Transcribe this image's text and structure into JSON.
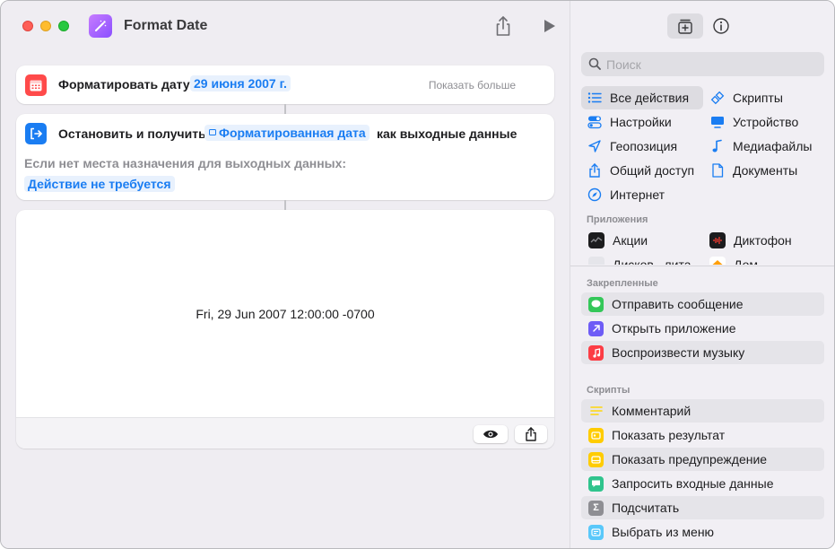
{
  "window": {
    "title": "Format Date"
  },
  "actions": {
    "format": {
      "label": "Форматировать дату",
      "token": "29 июня 2007 г.",
      "show_more": "Показать больше"
    },
    "stop": {
      "label_pre": "Остановить и получить",
      "token": "Форматированная дата",
      "label_post": "как выходные данные",
      "sub_label": "Если нет места назначения для выходных данных:",
      "sub_token": "Действие не требуется"
    },
    "output": {
      "text": "Fri, 29 Jun 2007 12:00:00 -0700"
    }
  },
  "sidebar": {
    "search_placeholder": "Поиск",
    "categories": [
      {
        "label": "Все действия",
        "icon": "list-icon",
        "selected": true
      },
      {
        "label": "Скрипты",
        "icon": "scripts-icon"
      },
      {
        "label": "Настройки",
        "icon": "toggle-icon"
      },
      {
        "label": "Устройство",
        "icon": "monitor-icon"
      },
      {
        "label": "Геопозиция",
        "icon": "location-arrow-icon"
      },
      {
        "label": "Медиафайлы",
        "icon": "music-note-icon"
      },
      {
        "label": "Общий доступ",
        "icon": "share-icon"
      },
      {
        "label": "Документы",
        "icon": "document-icon"
      },
      {
        "label": "Интернет",
        "icon": "compass-icon"
      }
    ],
    "apps_header": "Приложения",
    "apps": [
      {
        "label": "Акции",
        "icon": "stocks-icon"
      },
      {
        "label": "Диктофон",
        "icon": "voice-memos-icon"
      },
      {
        "label": "Дисков...лита",
        "icon": "disk-utility-icon"
      },
      {
        "label": "Дом",
        "icon": "home-icon"
      }
    ],
    "pinned_header": "Закрепленные",
    "pinned": [
      {
        "label": "Отправить сообщение",
        "icon": "messages-icon",
        "color": "#34c759"
      },
      {
        "label": "Открыть приложение",
        "icon": "open-app-icon",
        "color": "#6e5cf6"
      },
      {
        "label": "Воспроизвести музыку",
        "icon": "music-icon",
        "color": "#fc3c44"
      }
    ],
    "scripts_header": "Скрипты",
    "scripts": [
      {
        "label": "Комментарий",
        "icon": "comment-icon",
        "color": "#ffd60a"
      },
      {
        "label": "Показать результат",
        "icon": "show-result-icon",
        "color": "#ffcc00"
      },
      {
        "label": "Показать предупреждение",
        "icon": "alert-icon",
        "color": "#ffcc00"
      },
      {
        "label": "Запросить входные данные",
        "icon": "ask-input-icon",
        "color": "#30c48d"
      },
      {
        "label": "Подсчитать",
        "icon": "count-icon",
        "color": "#8e8e93"
      },
      {
        "label": "Выбрать из меню",
        "icon": "choose-menu-icon",
        "color": "#5ac8fa"
      }
    ]
  }
}
